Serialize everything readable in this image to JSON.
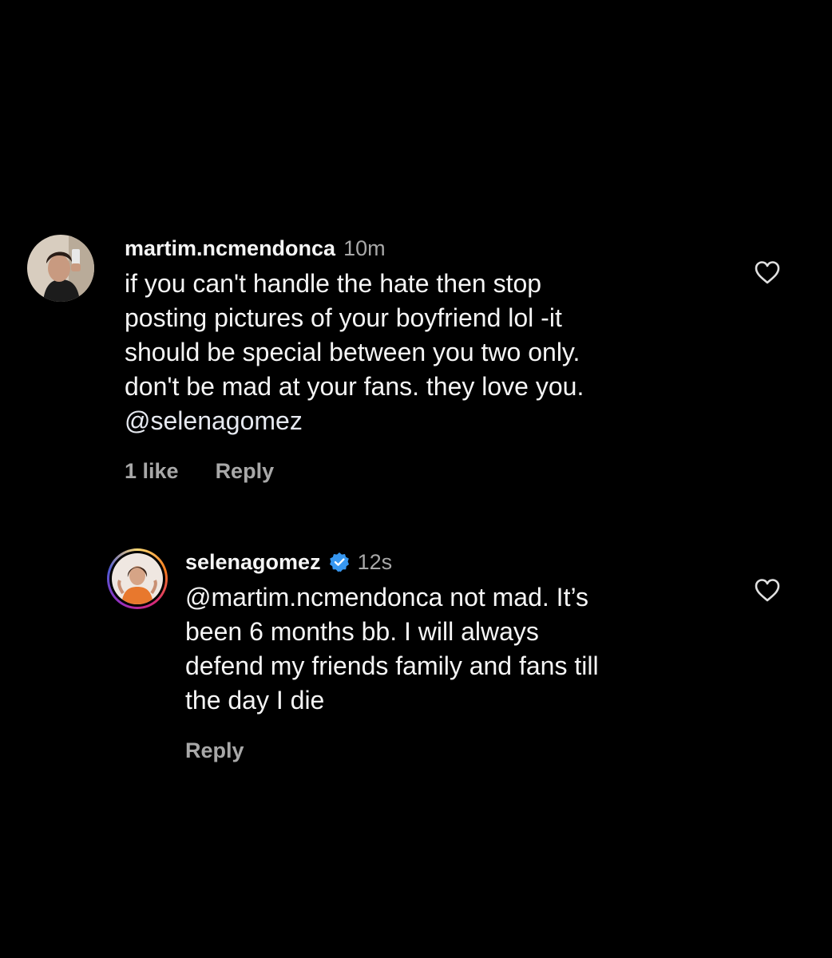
{
  "comments": [
    {
      "username": "martim.ncmendonca",
      "time": "10m",
      "text": "if you can't handle the hate then stop\nposting pictures of your boyfriend lol -it\nshould be special between you two only.\ndon't be mad at your fans. they love you.",
      "mention": "@selenagomez",
      "likes": "1 like",
      "reply": "Reply"
    },
    {
      "username": "selenagomez",
      "verified": true,
      "time": "12s",
      "text": "@martim.ncmendonca not mad. It’s\nbeen 6 months bb. I will always\ndefend my friends family and fans till\nthe day I die",
      "reply": "Reply"
    }
  ],
  "icons": {
    "heart": "heart-outline-icon",
    "verified": "verified-badge-icon"
  },
  "colors": {
    "background": "#000000",
    "text": "#f5f5f5",
    "muted": "#a8a8a8",
    "verified": "#3797f0"
  }
}
